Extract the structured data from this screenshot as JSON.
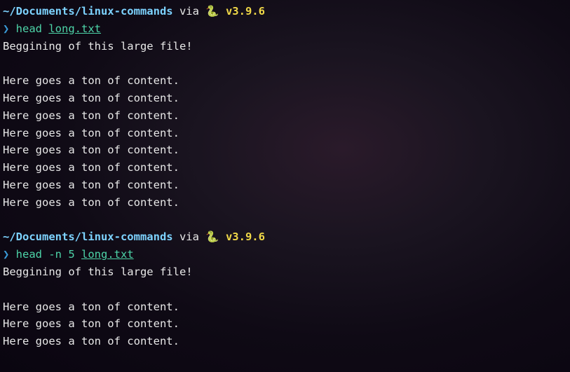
{
  "prompt1": {
    "path": "~/Documents/linux-commands",
    "via": " via ",
    "snake": "🐍 ",
    "version": "v3.9.6",
    "arrow": "❯",
    "command": " head ",
    "filename": "long.txt"
  },
  "output1": {
    "line1": "Beggining of this large file!",
    "line2": "",
    "line3": "Here goes a ton of content.",
    "line4": "Here goes a ton of content.",
    "line5": "Here goes a ton of content.",
    "line6": "Here goes a ton of content.",
    "line7": "Here goes a ton of content.",
    "line8": "Here goes a ton of content.",
    "line9": "Here goes a ton of content.",
    "line10": "Here goes a ton of content."
  },
  "prompt2": {
    "path": "~/Documents/linux-commands",
    "via": " via ",
    "snake": "🐍 ",
    "version": "v3.9.6",
    "arrow": "❯",
    "command": " head -n 5 ",
    "filename": "long.txt"
  },
  "output2": {
    "line1": "Beggining of this large file!",
    "line2": "",
    "line3": "Here goes a ton of content.",
    "line4": "Here goes a ton of content.",
    "line5": "Here goes a ton of content."
  }
}
